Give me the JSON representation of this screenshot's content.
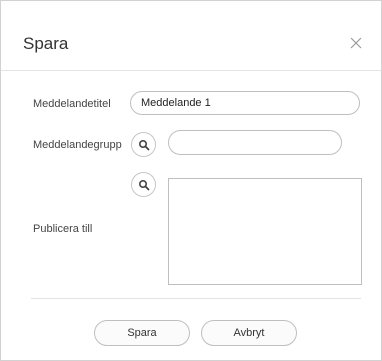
{
  "dialog": {
    "title": "Spara",
    "close_icon": "close-icon"
  },
  "form": {
    "title_label": "Meddelandetitel",
    "title_value": "Meddelande 1",
    "group_label": "Meddelandegrupp",
    "group_value": "",
    "publish_label": "Publicera till",
    "publish_value": "",
    "search_icon": "search-icon"
  },
  "buttons": {
    "save_label": "Spara",
    "cancel_label": "Avbryt"
  }
}
